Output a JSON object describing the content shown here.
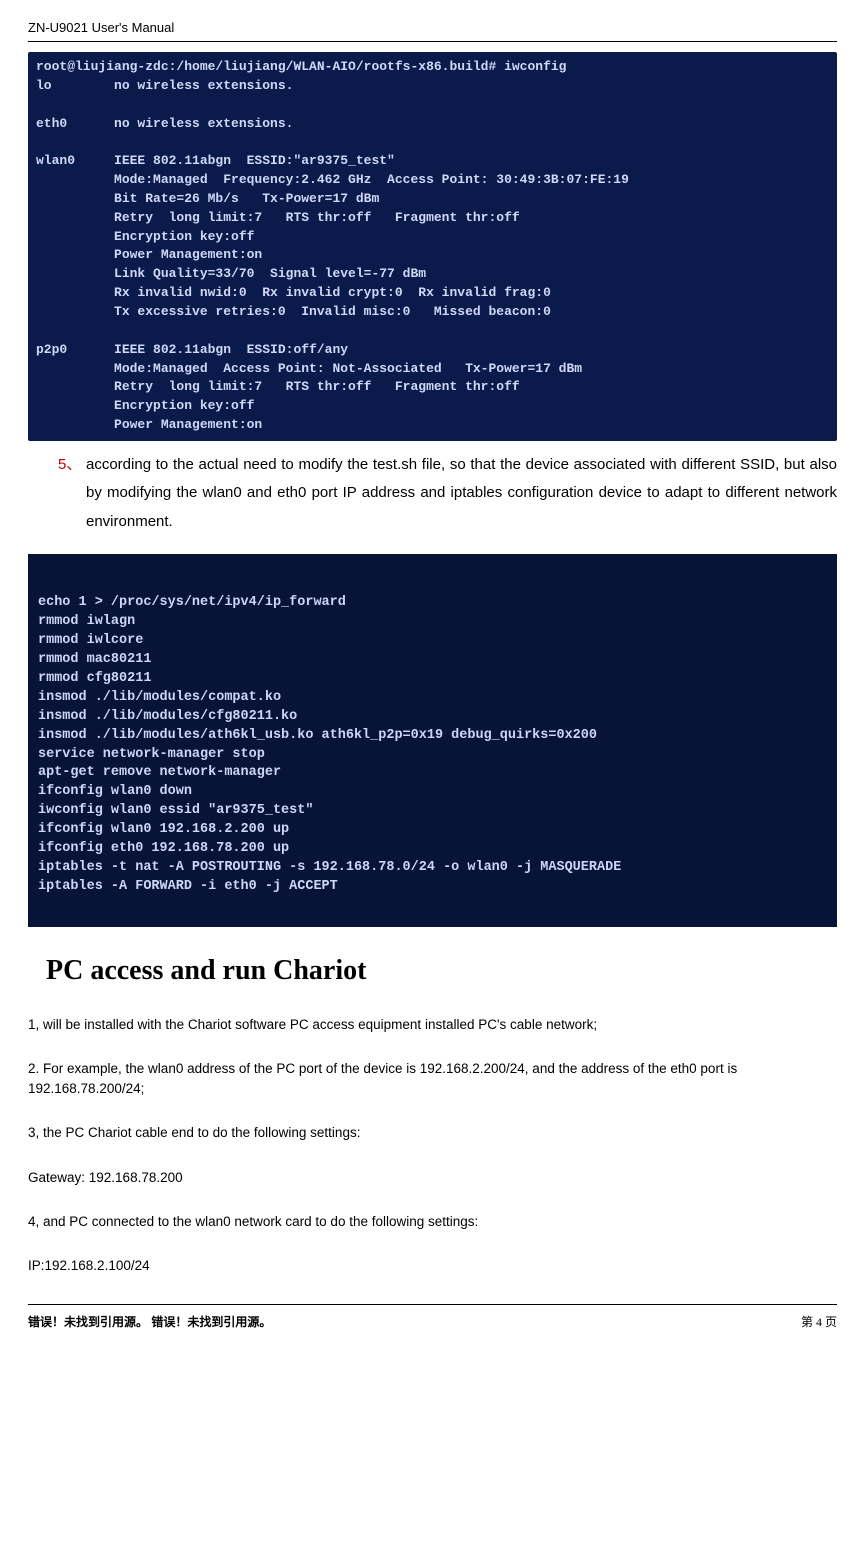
{
  "header": {
    "title": "ZN-U9021 User's Manual"
  },
  "terminal1": "root@liujiang-zdc:/home/liujiang/WLAN-AIO/rootfs-x86.build# iwconfig\nlo        no wireless extensions.\n\neth0      no wireless extensions.\n\nwlan0     IEEE 802.11abgn  ESSID:\"ar9375_test\"\n          Mode:Managed  Frequency:2.462 GHz  Access Point: 30:49:3B:07:FE:19\n          Bit Rate=26 Mb/s   Tx-Power=17 dBm\n          Retry  long limit:7   RTS thr:off   Fragment thr:off\n          Encryption key:off\n          Power Management:on\n          Link Quality=33/70  Signal level=-77 dBm\n          Rx invalid nwid:0  Rx invalid crypt:0  Rx invalid frag:0\n          Tx excessive retries:0  Invalid misc:0   Missed beacon:0\n\np2p0      IEEE 802.11abgn  ESSID:off/any\n          Mode:Managed  Access Point: Not-Associated   Tx-Power=17 dBm\n          Retry  long limit:7   RTS thr:off   Fragment thr:off\n          Encryption key:off\n          Power Management:on",
  "listItem5": {
    "num": "5、",
    "text": "according to the actual need to modify the test.sh file, so that the device associated with different SSID, but also by modifying the wlan0 and eth0 port IP address and iptables configuration device to adapt to different network environment."
  },
  "terminal2": "echo 1 > /proc/sys/net/ipv4/ip_forward\nrmmod iwlagn\nrmmod iwlcore\nrmmod mac80211\nrmmod cfg80211\ninsmod ./lib/modules/compat.ko\ninsmod ./lib/modules/cfg80211.ko\ninsmod ./lib/modules/ath6kl_usb.ko ath6kl_p2p=0x19 debug_quirks=0x200\nservice network-manager stop\napt-get remove network-manager\nifconfig wlan0 down\niwconfig wlan0 essid \"ar9375_test\"\nifconfig wlan0 192.168.2.200 up\nifconfig eth0 192.168.78.200 up\niptables -t nat -A POSTROUTING -s 192.168.78.0/24 -o wlan0 -j MASQUERADE\niptables -A FORWARD -i eth0 -j ACCEPT",
  "sectionHeading": "PC access and run Chariot",
  "paragraphs": {
    "p1": "1, will be installed with the Chariot software PC access equipment installed PC's cable network;",
    "p2": "2. For example, the wlan0 address of the PC port of the device is 192.168.2.200/24, and the address of the eth0 port is 192.168.78.200/24;",
    "p3": "3, the PC Chariot cable end to do the following settings:",
    "p4": "Gateway: 192.168.78.200",
    "p5": "4, and PC connected to the wlan0 network card to do the following settings:",
    "p6": "IP:192.168.2.100/24"
  },
  "footer": {
    "left": "错误！未找到引用源。  错误！未找到引用源。",
    "right": "第 4 页"
  }
}
